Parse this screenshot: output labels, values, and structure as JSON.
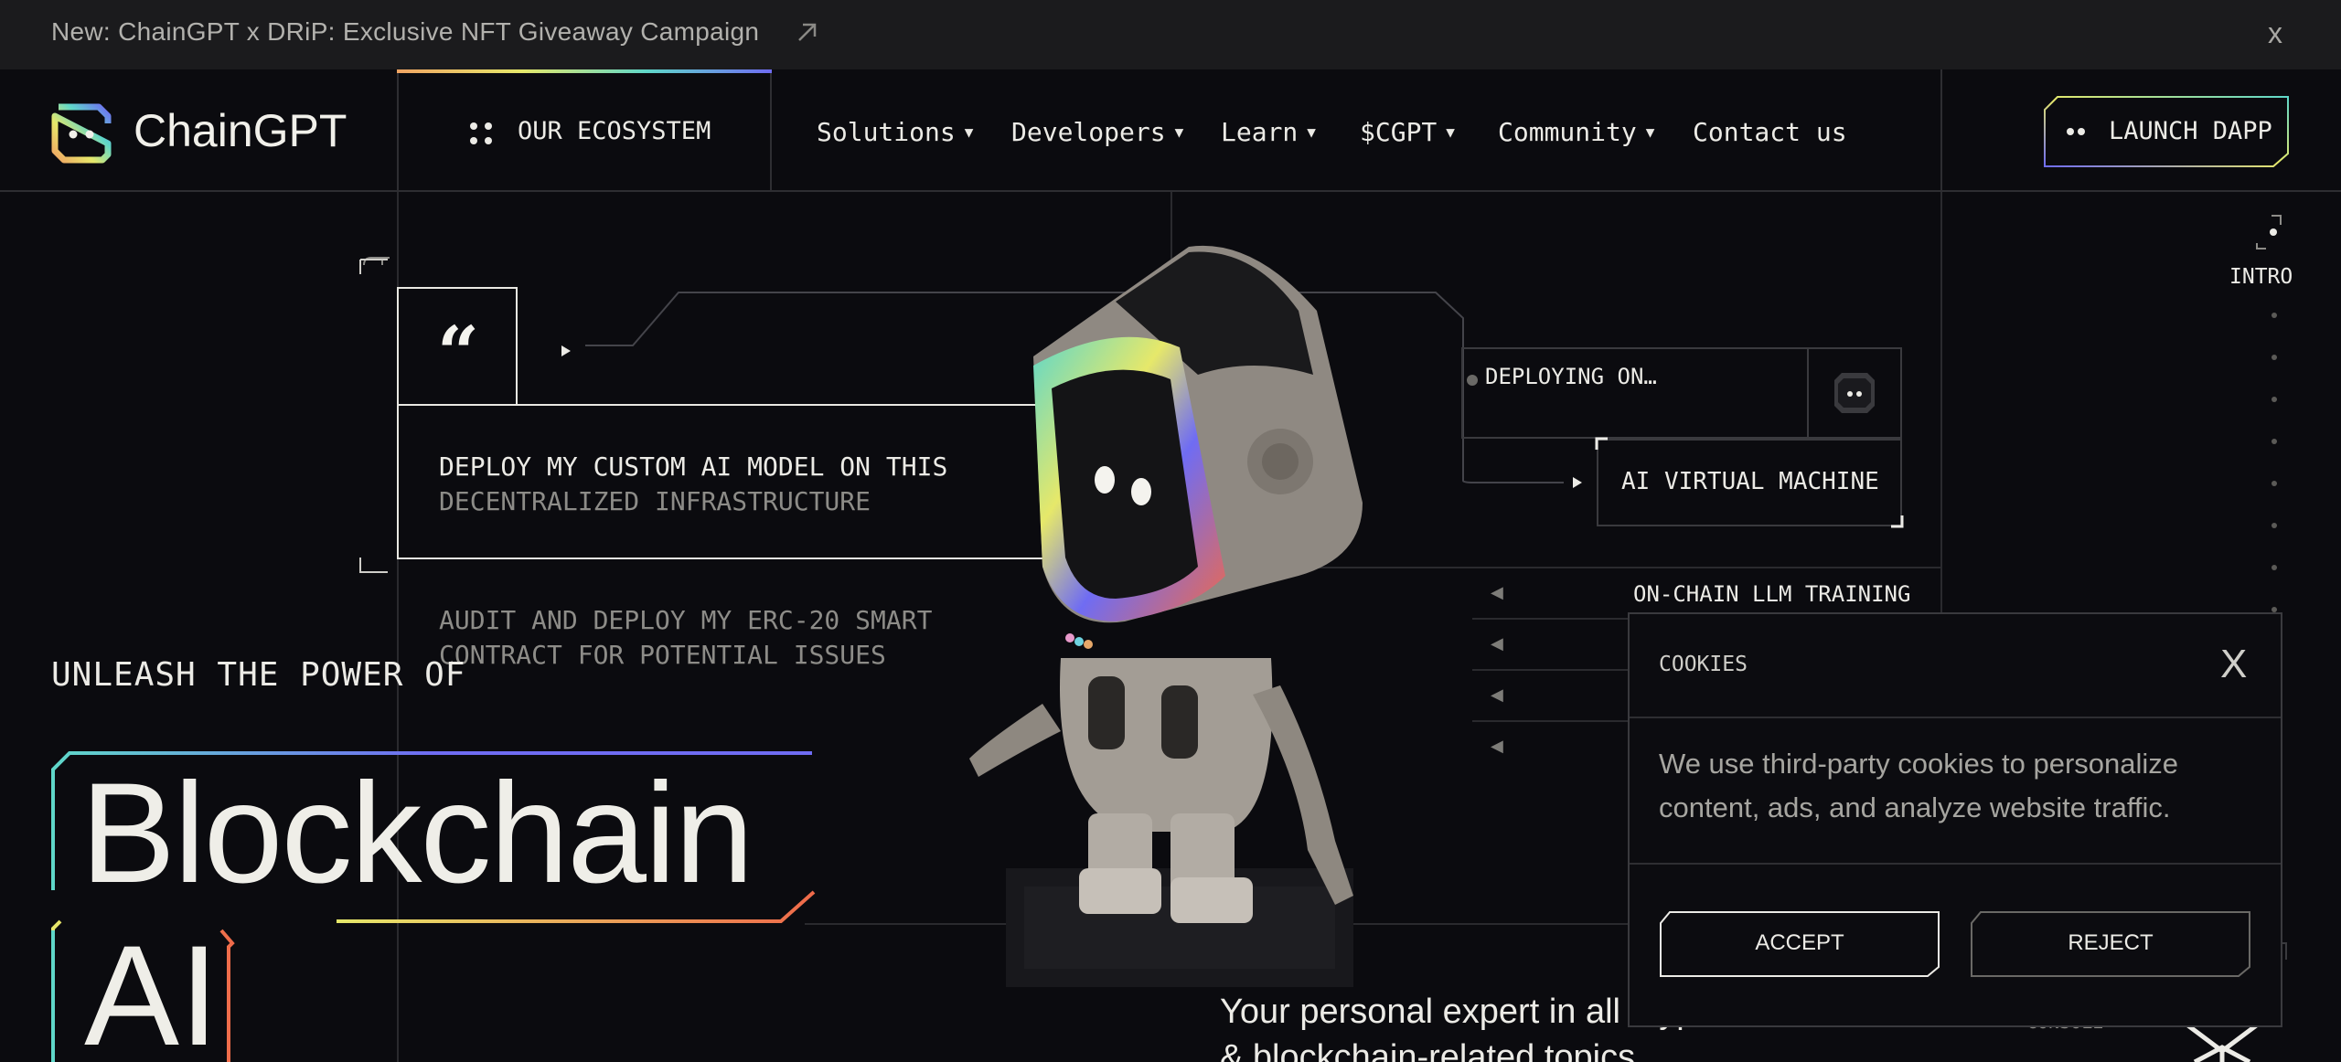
{
  "announcement": {
    "text": "New: ChainGPT x DRiP: Exclusive NFT Giveaway Campaign",
    "arrow_icon": "arrow-up-right-icon",
    "close": "x"
  },
  "header": {
    "logo_text": "ChainGPT",
    "ecosystem_label": "OUR ECOSYSTEM",
    "nav": [
      {
        "label": "Solutions",
        "dropdown": true
      },
      {
        "label": "Developers",
        "dropdown": true
      },
      {
        "label": "Learn",
        "dropdown": true
      },
      {
        "label": "$CGPT",
        "dropdown": true
      },
      {
        "label": "Community",
        "dropdown": true
      },
      {
        "label": "Contact us",
        "dropdown": false
      }
    ],
    "launch_label": "LAUNCH DAPP"
  },
  "hero": {
    "quote_mark": "“",
    "prompt1_line1": "DEPLOY MY CUSTOM AI MODEL ON THIS",
    "prompt1_line2": "DECENTRALIZED INFRASTRUCTURE",
    "prompt2_line1": "AUDIT AND DEPLOY MY ERC-20 SMART",
    "prompt2_line2": "CONTRACT FOR POTENTIAL ISSUES",
    "eyebrow": "UNLEASH THE POWER OF",
    "headline_line1": "Blockchain",
    "headline_line2": "AI",
    "deploying": "DEPLOYING ON…",
    "virtual_machine": "AI VIRTUAL MACHINE",
    "training": "ON-CHAIN LLM TRAINING",
    "subtitle_line1": "Your personal expert in all cryp",
    "subtitle_line2": "& blockchain-related topics",
    "console_label": "CONSOLE"
  },
  "side_nav": {
    "active": "INTRO"
  },
  "cookies": {
    "title": "COOKIES",
    "close": "X",
    "body_line1": "We use third-party cookies to personalize",
    "body_line2": "content, ads, and analyze website traffic.",
    "accept": "ACCEPT",
    "reject": "REJECT"
  },
  "colors": {
    "background": "#0b0b0f",
    "announce_bg": "#1b1b1d",
    "text": "#ecebe6",
    "muted": "#8d8c88",
    "gradient": [
      "#f0a463",
      "#e6e86a",
      "#5fd7c9",
      "#6f6cf3"
    ]
  }
}
